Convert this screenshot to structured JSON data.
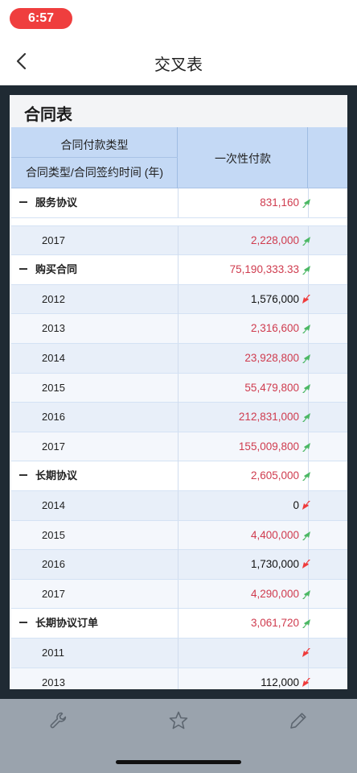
{
  "status_bar": {
    "time": "6:57"
  },
  "nav": {
    "title": "交叉表"
  },
  "card": {
    "title": "合同表"
  },
  "table": {
    "header": {
      "top_left": "合同付款类型",
      "bottom_left": "合同类型/合同签约时间 (年)",
      "column": "一次性付款"
    },
    "rows": [
      {
        "kind": "group",
        "label": "服务协议",
        "value": "831,160",
        "color": "red",
        "trend": "up"
      },
      {
        "kind": "partial"
      },
      {
        "kind": "child",
        "label": "2017",
        "value": "2,228,000",
        "color": "red",
        "trend": "up"
      },
      {
        "kind": "group",
        "label": "购买合同",
        "value": "75,190,333.33",
        "color": "red",
        "trend": "up"
      },
      {
        "kind": "child",
        "label": "2012",
        "value": "1,576,000",
        "color": "black",
        "trend": "down"
      },
      {
        "kind": "child",
        "label": "2013",
        "value": "2,316,600",
        "color": "red",
        "trend": "up"
      },
      {
        "kind": "child",
        "label": "2014",
        "value": "23,928,800",
        "color": "red",
        "trend": "up"
      },
      {
        "kind": "child",
        "label": "2015",
        "value": "55,479,800",
        "color": "red",
        "trend": "up"
      },
      {
        "kind": "child",
        "label": "2016",
        "value": "212,831,000",
        "color": "red",
        "trend": "up"
      },
      {
        "kind": "child",
        "label": "2017",
        "value": "155,009,800",
        "color": "red",
        "trend": "up"
      },
      {
        "kind": "group",
        "label": "长期协议",
        "value": "2,605,000",
        "color": "red",
        "trend": "up"
      },
      {
        "kind": "child",
        "label": "2014",
        "value": "0",
        "color": "black",
        "trend": "down"
      },
      {
        "kind": "child",
        "label": "2015",
        "value": "4,400,000",
        "color": "red",
        "trend": "up"
      },
      {
        "kind": "child",
        "label": "2016",
        "value": "1,730,000",
        "color": "black",
        "trend": "down"
      },
      {
        "kind": "child",
        "label": "2017",
        "value": "4,290,000",
        "color": "red",
        "trend": "up"
      },
      {
        "kind": "group",
        "label": "长期协议订单",
        "value": "3,061,720",
        "color": "red",
        "trend": "up"
      },
      {
        "kind": "child",
        "label": "2011",
        "value": "",
        "color": "black",
        "trend": "down"
      },
      {
        "kind": "child",
        "label": "2013",
        "value": "112,000",
        "color": "black",
        "trend": "down"
      }
    ]
  },
  "colors": {
    "up_arrow": "#4cb865",
    "down_arrow": "#ef3b3b",
    "red_value": "#cf3b4e",
    "header_bg": "#c4d9f5"
  },
  "toolbar": {
    "icons": [
      "wrench-icon",
      "star-icon",
      "pencil-icon"
    ]
  }
}
